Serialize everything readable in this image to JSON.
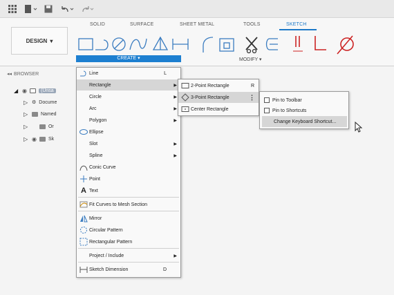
{
  "ribbon": {
    "design_label": "DESIGN",
    "tabs": [
      "SOLID",
      "SURFACE",
      "SHEET METAL",
      "TOOLS",
      "SKETCH"
    ],
    "active_tab": "SKETCH",
    "create_label": "CREATE ▾",
    "modify_label": "MODIFY ▾"
  },
  "browser": {
    "header": "BROWSER",
    "items": [
      "(Unsa",
      "Docume",
      "Named ",
      "Or",
      "Sk"
    ]
  },
  "create_menu": {
    "items": [
      {
        "label": "Line",
        "shortcut": "L"
      },
      {
        "label": "Rectangle",
        "submenu": true
      },
      {
        "label": "Circle",
        "submenu": true
      },
      {
        "label": "Arc",
        "submenu": true
      },
      {
        "label": "Polygon",
        "submenu": true
      },
      {
        "label": "Ellipse"
      },
      {
        "label": "Slot",
        "submenu": true
      },
      {
        "label": "Spline",
        "submenu": true
      },
      {
        "label": "Conic Curve"
      },
      {
        "label": "Point"
      },
      {
        "label": "Text"
      },
      {
        "label": "Fit Curves to Mesh Section"
      },
      {
        "label": "Mirror"
      },
      {
        "label": "Circular Pattern"
      },
      {
        "label": "Rectangular Pattern"
      },
      {
        "label": "Project / Include",
        "submenu": true
      },
      {
        "label": "Sketch Dimension",
        "shortcut": "D"
      }
    ]
  },
  "rectangle_menu": {
    "items": [
      {
        "label": "2-Point Rectangle",
        "shortcut": "R"
      },
      {
        "label": "3-Point Rectangle"
      },
      {
        "label": "Center Rectangle"
      }
    ]
  },
  "options_menu": {
    "items": [
      {
        "label": "Pin to Toolbar"
      },
      {
        "label": "Pin to Shortcuts"
      },
      {
        "label": "Change Keyboard Shortcut..."
      }
    ]
  },
  "colors": {
    "accent": "#1d7fd0",
    "highlight": "#d6d6d6"
  }
}
